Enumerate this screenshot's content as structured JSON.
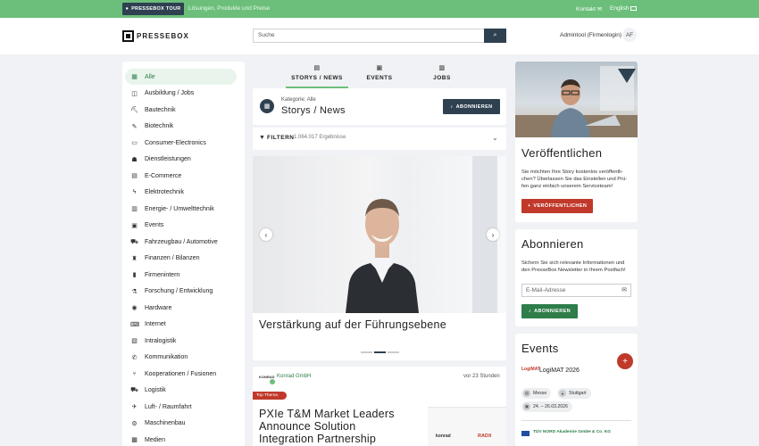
{
  "topbar": {
    "tour_label": "PRESSEBOX TOUR",
    "subtitle": "Lösungen, Produkte und Preise",
    "contact": "Kontakt",
    "language": "English"
  },
  "header": {
    "logo": "PRESSEBOX",
    "search_placeholder": "Suche",
    "user_name": "Admintool (Firmenlogin)",
    "user_initials": "AF"
  },
  "sidebar": {
    "items": [
      {
        "label": "Alle",
        "icon": "grid-icon",
        "glyph": "▦"
      },
      {
        "label": "Ausbildung / Jobs",
        "icon": "graduation-icon",
        "glyph": "◫"
      },
      {
        "label": "Bautechnik",
        "icon": "crane-icon",
        "glyph": "⛏"
      },
      {
        "label": "Biotechnik",
        "icon": "syringe-icon",
        "glyph": "✎"
      },
      {
        "label": "Consumer-Electronics",
        "icon": "devices-icon",
        "glyph": "▭"
      },
      {
        "label": "Dienstleistungen",
        "icon": "service-icon",
        "glyph": "☗"
      },
      {
        "label": "E-Commerce",
        "icon": "cart-icon",
        "glyph": "▤"
      },
      {
        "label": "Elektrotechnik",
        "icon": "bolt-icon",
        "glyph": "ϟ"
      },
      {
        "label": "Energie- / Umwelttechnik",
        "icon": "solar-icon",
        "glyph": "▥"
      },
      {
        "label": "Events",
        "icon": "calendar-icon",
        "glyph": "▣"
      },
      {
        "label": "Fahrzeugbau / Automotive",
        "icon": "car-icon",
        "glyph": "⛟"
      },
      {
        "label": "Finanzen / Bilanzen",
        "icon": "piggy-bank-icon",
        "glyph": "♜"
      },
      {
        "label": "Firmenintern",
        "icon": "building-icon",
        "glyph": "▮"
      },
      {
        "label": "Forschung / Entwicklung",
        "icon": "lab-icon",
        "glyph": "⚗"
      },
      {
        "label": "Hardware",
        "icon": "chip-icon",
        "glyph": "◉"
      },
      {
        "label": "Internet",
        "icon": "laptop-icon",
        "glyph": "⌨"
      },
      {
        "label": "Intralogistik",
        "icon": "warehouse-icon",
        "glyph": "▧"
      },
      {
        "label": "Kommunikation",
        "icon": "satellite-icon",
        "glyph": "✆"
      },
      {
        "label": "Kooperationen / Fusionen",
        "icon": "merge-icon",
        "glyph": "⑂"
      },
      {
        "label": "Logistik",
        "icon": "truck-icon",
        "glyph": "⛟"
      },
      {
        "label": "Luft- / Raumfahrt",
        "icon": "plane-icon",
        "glyph": "✈"
      },
      {
        "label": "Maschinenbau",
        "icon": "gears-icon",
        "glyph": "⚙"
      },
      {
        "label": "Medien",
        "icon": "media-icon",
        "glyph": "▩"
      }
    ]
  },
  "tabs": [
    {
      "label": "STORYS / NEWS",
      "icon": "news-icon",
      "active": true
    },
    {
      "label": "EVENTS",
      "icon": "calendar-icon",
      "active": false
    },
    {
      "label": "JOBS",
      "icon": "briefcase-icon",
      "active": false
    }
  ],
  "category": {
    "label": "Kategorie: Alle",
    "title": "Storys / News",
    "subscribe_label": "ABONNIEREN"
  },
  "filter": {
    "label": "FILTERN",
    "count": "1.064.017 Ergebnisse"
  },
  "slider": {
    "title": "Verstärkung auf der Führungsebene",
    "current": 2,
    "total": 3
  },
  "story": {
    "company_logo_text": "KONRAD",
    "company": "Konrad GmbH",
    "time": "vor 23 Stunden",
    "badge": "Top Thema",
    "title": "PXIe T&M Market Leaders Announce Solution Integration Partnership",
    "thumb_left": "konrad",
    "thumb_right": "RADX"
  },
  "publish": {
    "heading": "Veröffentlichen",
    "text": "Sie möchten Ihre Story kostenlos veröffentli-chen? Überlassen Sie das Einstellen und Prü-fen ganz einfach unserem Serviceteam!",
    "button": "VERÖFFENTLICHEN"
  },
  "subscribe": {
    "heading": "Abonnieren",
    "text": "Sichern Sie sich relevante Informationen und den PresseBox Newsletter in Ihrem Postfach!",
    "email_placeholder": "E-Mail-Adresse",
    "button": "ABONNIEREN"
  },
  "events": {
    "heading": "Events",
    "items": [
      {
        "logo_text": "LogiMAT",
        "name": "LogiMAT 2026",
        "type": "Messe",
        "city": "Stuttgart",
        "dates": "24. – 26.03.2026"
      }
    ],
    "next_org": "TÜV NORD Akademie GmbH & Co. KG"
  },
  "colors": {
    "brand_green": "#6bbf7a",
    "dark_navy": "#2f4150",
    "accent_red": "#c0392b"
  }
}
